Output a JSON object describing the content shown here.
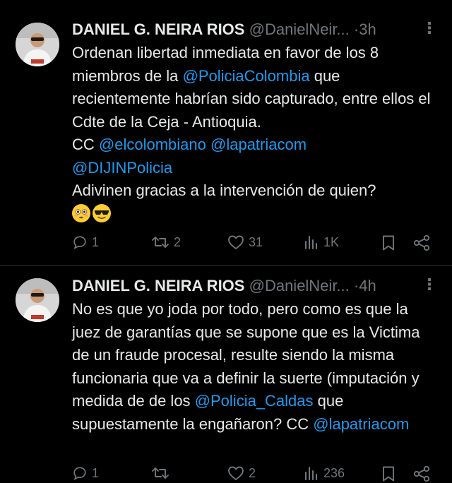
{
  "tweets": [
    {
      "author_name": "DANIEL G. NEIRA RIOS",
      "handle": "@DanielNeir...",
      "separator": "·",
      "time": "3h",
      "more": "⋮",
      "text": {
        "p1": "Ordenan libertad inmediata en favor de los 8 miembros de la ",
        "m1": "@PoliciaColombia",
        "p2": " que recientemente habrían sido capturado, entre ellos el Cdte de la Ceja - Antioquia.",
        "p3": "CC ",
        "m2": "@elcolombiano",
        "m3": "@lapatriacom",
        "m4": "@DIJINPolicia",
        "p4": "Adivinen gracias a la intervención de quien?"
      },
      "emojis": [
        "flushed-face",
        "sunglasses-face"
      ],
      "actions": {
        "replies": "1",
        "reposts": "2",
        "likes": "31",
        "views": "1K"
      }
    },
    {
      "author_name": "DANIEL G. NEIRA RIOS",
      "handle": "@DanielNeir...",
      "separator": "·",
      "time": "4h",
      "more": "⋮",
      "text": {
        "p1": "No es que yo joda por todo, pero como es que la juez de garantías que se supone que es la Victima de un fraude procesal, resulte siendo la misma funcionaria que va a definir la suerte (imputación y medida de de los ",
        "m1": "@Policia_Caldas",
        "p2": " que supuestamente la engañaron? CC ",
        "m2": "@lapatriacom"
      },
      "actions": {
        "replies": "1",
        "reposts": "",
        "likes": "2",
        "views": "236"
      }
    }
  ],
  "colors": {
    "background": "#000000",
    "text": "#e7e9ea",
    "muted": "#71767b",
    "mention": "#1d9bf0",
    "divider": "#2f3336"
  }
}
